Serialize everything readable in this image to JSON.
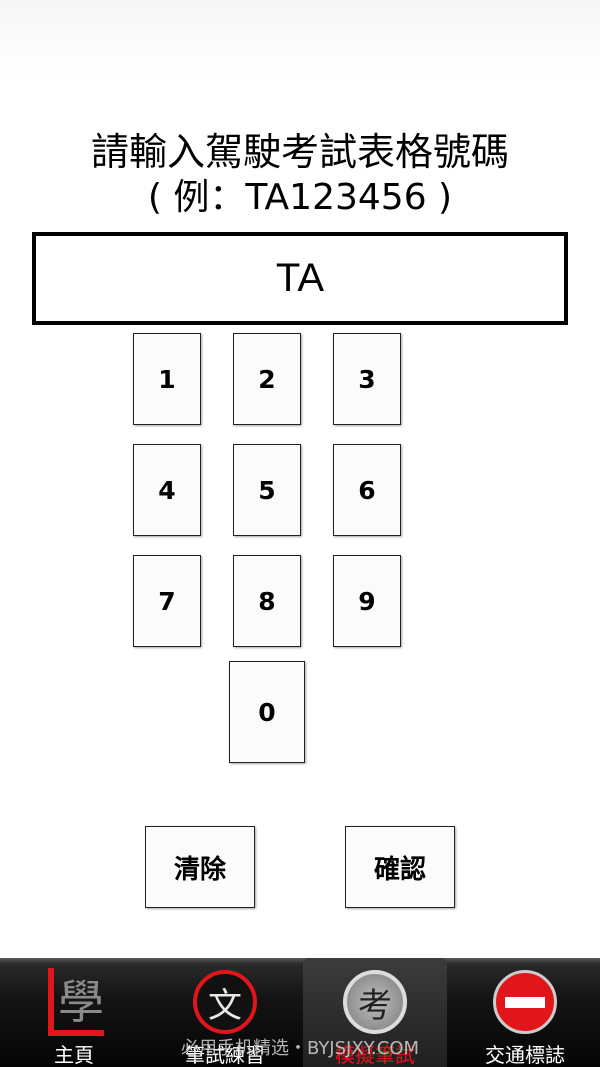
{
  "prompt": {
    "line1": "請輸入駕駛考試表格號碼",
    "line2": "( 例：TA123456 )"
  },
  "input": {
    "value": "TA"
  },
  "keypad": {
    "k1": "1",
    "k2": "2",
    "k3": "3",
    "k4": "4",
    "k5": "5",
    "k6": "6",
    "k7": "7",
    "k8": "8",
    "k9": "9",
    "k0": "0"
  },
  "actions": {
    "clear": "清除",
    "confirm": "確認"
  },
  "tabs": {
    "home": {
      "label": "主頁",
      "icon": "xue-char-icon",
      "glyph": "學"
    },
    "practice": {
      "label": "筆試練習",
      "icon": "wen-char-icon",
      "glyph": "文"
    },
    "mock": {
      "label": "模擬筆試",
      "icon": "kao-char-icon",
      "glyph": "考",
      "active": true
    },
    "signs": {
      "label": "交通標誌",
      "icon": "no-entry-icon"
    }
  },
  "watermark": "必用手机精选・BYJSJXY.COM",
  "colors": {
    "accent": "#e0161b",
    "tabbar": "#141414",
    "background": "#ffffff"
  }
}
